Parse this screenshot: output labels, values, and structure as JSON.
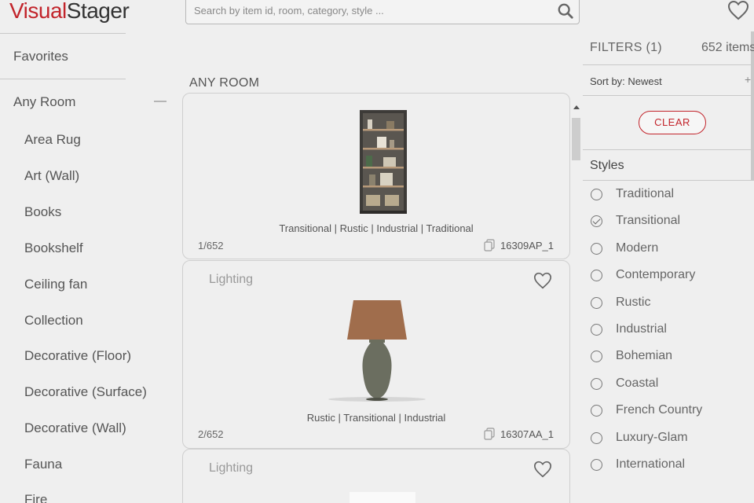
{
  "header": {
    "logo_part1": "Visual",
    "logo_part2": "Stager",
    "search_placeholder": "Search by item id, room, category, style ...",
    "brand_color": "#c2242b"
  },
  "sidebar": {
    "favorites": "Favorites",
    "any_room": "Any Room",
    "items": [
      "Area Rug",
      "Art (Wall)",
      "Books",
      "Bookshelf",
      "Ceiling fan",
      "Collection",
      "Decorative (Floor)",
      "Decorative (Surface)",
      "Decorative (Wall)",
      "Fauna",
      "Fire"
    ]
  },
  "main": {
    "section_title": "ANY ROOM",
    "cards": [
      {
        "category": "",
        "tags": "Transitional | Rustic | Industrial | Traditional",
        "index": "1/652",
        "sku": "16309AP_1",
        "image": "bookshelf"
      },
      {
        "category": "Lighting",
        "tags": "Rustic | Transitional | Industrial",
        "index": "2/652",
        "sku": "16307AA_1",
        "image": "table-lamp"
      },
      {
        "category": "Lighting",
        "tags": "",
        "index": "",
        "sku": "",
        "image": ""
      }
    ]
  },
  "filters": {
    "title": "FILTERS (1)",
    "count": "652 items",
    "sort": "Sort by: Newest",
    "clear": "CLEAR",
    "styles_heading": "Styles",
    "styles": [
      {
        "label": "Traditional",
        "checked": false
      },
      {
        "label": "Transitional",
        "checked": true
      },
      {
        "label": "Modern",
        "checked": false
      },
      {
        "label": "Contemporary",
        "checked": false
      },
      {
        "label": "Rustic",
        "checked": false
      },
      {
        "label": "Industrial",
        "checked": false
      },
      {
        "label": "Bohemian",
        "checked": false
      },
      {
        "label": "Coastal",
        "checked": false
      },
      {
        "label": "French Country",
        "checked": false
      },
      {
        "label": "Luxury-Glam",
        "checked": false
      },
      {
        "label": "International",
        "checked": false
      }
    ]
  }
}
